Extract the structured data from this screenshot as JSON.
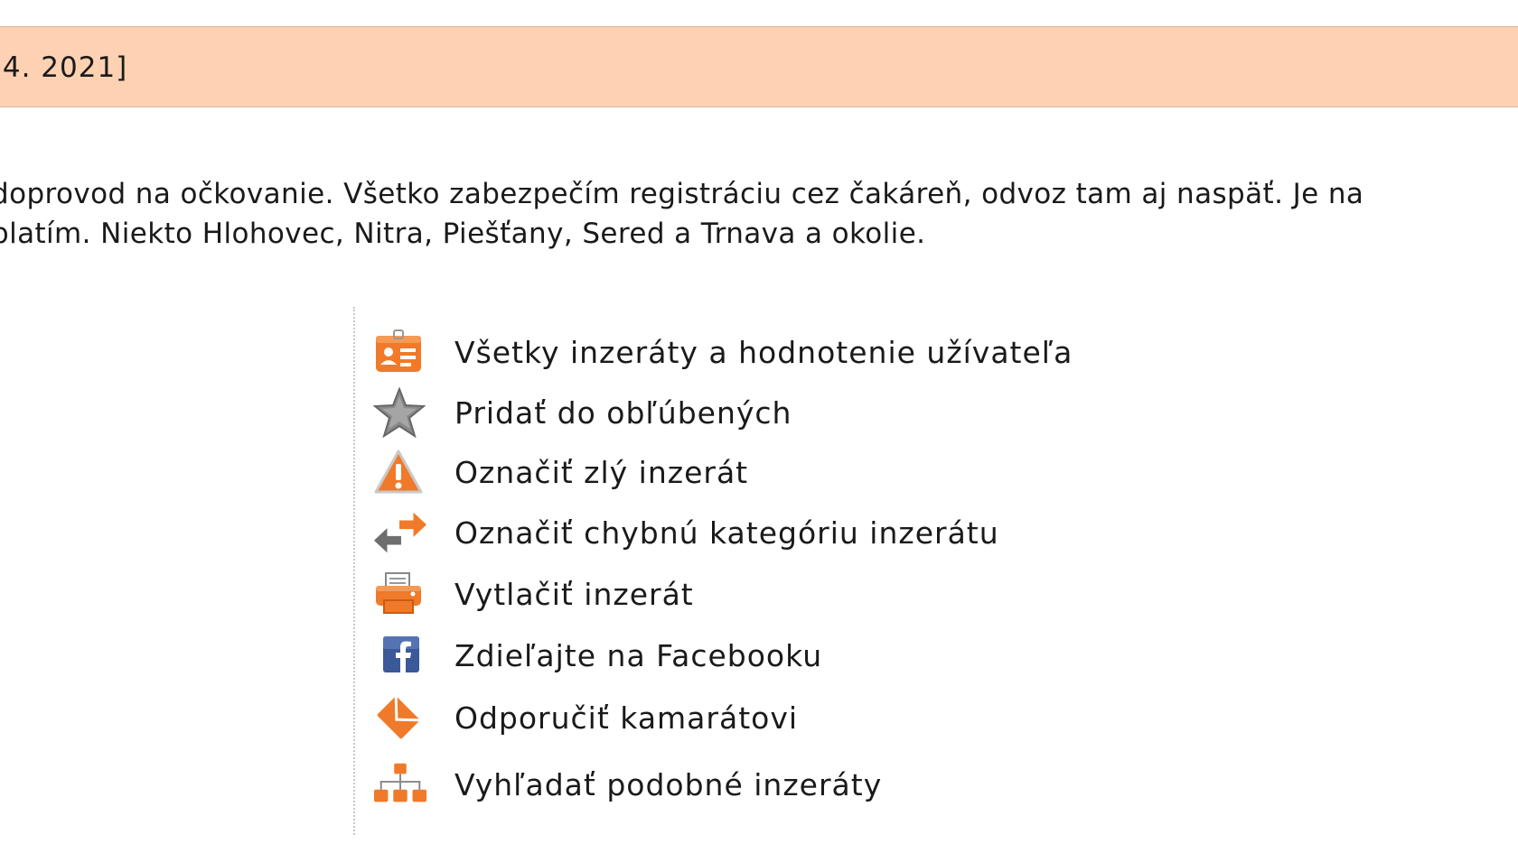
{
  "header": {
    "date_fragment": ".4. 2021]"
  },
  "description": {
    "line1": "doprovod na očkovanie. Všetko zabezpečím registráciu cez čakáreň, odvoz tam aj naspäť. Je na",
    "line2": "platím. Niekto Hlohovec, Nitra, Piešťany, Sered a Trnava a okolie."
  },
  "actions": [
    {
      "label": "Všetky inzeráty a hodnotenie užívateľa",
      "icon": "user-card-icon"
    },
    {
      "label": "Pridať do obľúbených",
      "icon": "star-icon"
    },
    {
      "label": "Označiť zlý inzerát",
      "icon": "warning-icon"
    },
    {
      "label": "Označiť chybnú kategóriu inzerátu",
      "icon": "swap-arrows-icon"
    },
    {
      "label": "Vytlačiť inzerát",
      "icon": "printer-icon"
    },
    {
      "label": "Zdieľajte na Facebooku",
      "icon": "facebook-icon"
    },
    {
      "label": "Odporučiť kamarátovi",
      "icon": "envelope-icon"
    },
    {
      "label": "Vyhľadať podobné inzeráty",
      "icon": "sitemap-icon"
    }
  ],
  "colors": {
    "header_background": "#fdd1b1",
    "icon_orange": "#f07a2a",
    "icon_gray": "#7a7a7a",
    "facebook_blue": "#3b5998"
  }
}
